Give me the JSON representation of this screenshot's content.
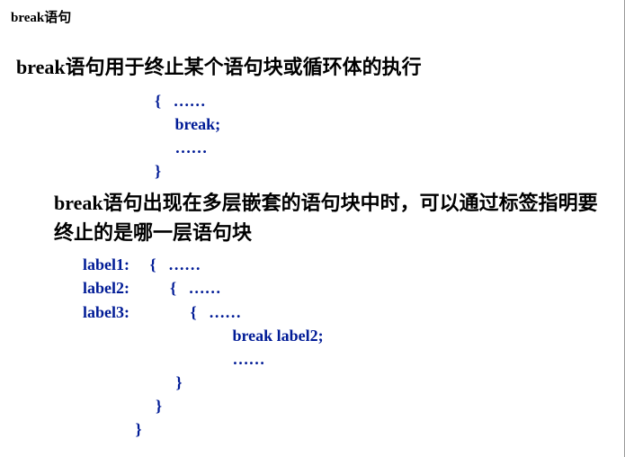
{
  "title": "break语句",
  "desc1": "break语句用于终止某个语句块或循环体的执行",
  "code1": "{   ……\n     break;\n     ……\n}",
  "desc2": "break语句出现在多层嵌套的语句块中时，可以通过标签指明要终止的是哪一层语句块",
  "code2": "label1:     {   ……\nlabel2:          {   ……\nlabel3:               {   ……\n                                     break label2;\n                                     ……\n                       }\n                  }\n             }"
}
